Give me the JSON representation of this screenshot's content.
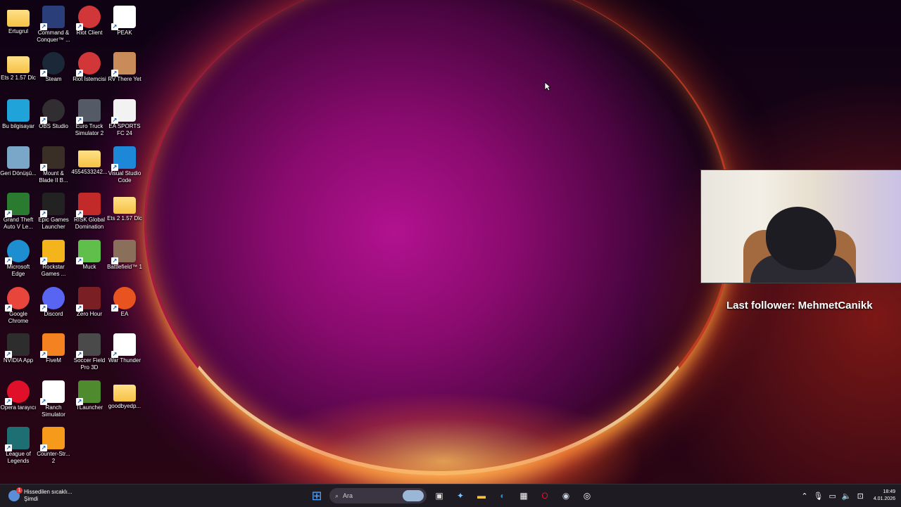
{
  "desktop": {
    "icons": [
      {
        "label": "Ertugrul",
        "icon": "folder-icon",
        "color": "#f5c242"
      },
      {
        "label": "Command & Conquer™ ...",
        "icon": "command-conquer-icon",
        "color": "#2a3f7a"
      },
      {
        "label": "Riot Client",
        "icon": "riot-client-icon",
        "color": "#d13639"
      },
      {
        "label": "PEAK",
        "icon": "file-icon",
        "color": "#ffffff"
      },
      {
        "label": "Ets 2 1.57 Dlc",
        "icon": "folder-icon",
        "color": "#f5c242"
      },
      {
        "label": "Steam",
        "icon": "steam-icon",
        "color": "#1b2838"
      },
      {
        "label": "Riot İstemcisi",
        "icon": "riot-client-icon",
        "color": "#d13639"
      },
      {
        "label": "RV There Yet",
        "icon": "rv-there-yet-icon",
        "color": "#c98b5a"
      },
      {
        "label": "Bu bilgisayar",
        "icon": "computer-icon",
        "color": "#1fa3d8"
      },
      {
        "label": "OBS Studio",
        "icon": "obs-icon",
        "color": "#302e31"
      },
      {
        "label": "Euro Truck Simulator 2",
        "icon": "euro-truck-icon",
        "color": "#555b66"
      },
      {
        "label": "EA SPORTS FC 24",
        "icon": "ea-fc-icon",
        "color": "#f2f2f2"
      },
      {
        "label": "Geri Dönüşü...",
        "icon": "recycle-bin-icon",
        "color": "#7aa6c8"
      },
      {
        "label": "Mount & Blade II B...",
        "icon": "mount-blade-icon",
        "color": "#3a2f26"
      },
      {
        "label": "4554533242...",
        "icon": "folder-icon",
        "color": "#f5c242"
      },
      {
        "label": "Visual Studio Code",
        "icon": "vscode-icon",
        "color": "#1e88d8"
      },
      {
        "label": "Grand Theft Auto V Le...",
        "icon": "gta-icon",
        "color": "#2a7a2f"
      },
      {
        "label": "Epic Games Launcher",
        "icon": "epic-games-icon",
        "color": "#222222"
      },
      {
        "label": "RISK Global Domination",
        "icon": "risk-icon",
        "color": "#c22a2a"
      },
      {
        "label": "Ets 2 1.57 Dlc",
        "icon": "folder-icon",
        "color": "#f5c242"
      },
      {
        "label": "Microsoft Edge",
        "icon": "edge-icon",
        "color": "#1d8fd1"
      },
      {
        "label": "Rockstar Games ...",
        "icon": "rockstar-icon",
        "color": "#f3b51b"
      },
      {
        "label": "Muck",
        "icon": "muck-icon",
        "color": "#5fbf4a"
      },
      {
        "label": "Battlefield™ 1",
        "icon": "battlefield-icon",
        "color": "#8a6f5a"
      },
      {
        "label": "Google Chrome",
        "icon": "chrome-icon",
        "color": "#e8453c"
      },
      {
        "label": "Discord",
        "icon": "discord-icon",
        "color": "#5865f2"
      },
      {
        "label": "Zero Hour",
        "icon": "zero-hour-icon",
        "color": "#7a1f24"
      },
      {
        "label": "EA",
        "icon": "ea-icon",
        "color": "#e8531f"
      },
      {
        "label": "NVIDIA App",
        "icon": "nvidia-icon",
        "color": "#2d2d2d"
      },
      {
        "label": "FiveM",
        "icon": "fivem-icon",
        "color": "#f58220"
      },
      {
        "label": "Soccer Field Pro 3D",
        "icon": "soccer-field-icon",
        "color": "#4a4a4a"
      },
      {
        "label": "War Thunder",
        "icon": "war-thunder-icon",
        "color": "#ffffff"
      },
      {
        "label": "Opera tarayıcı",
        "icon": "opera-icon",
        "color": "#e0102b"
      },
      {
        "label": "Ranch Simulator",
        "icon": "ranch-simulator-icon",
        "color": "#ffffff"
      },
      {
        "label": "TLauncher",
        "icon": "tlauncher-icon",
        "color": "#4f8a2f"
      },
      {
        "label": "goodbyedp...",
        "icon": "folder-icon",
        "color": "#f5c242"
      },
      {
        "label": "League of Legends",
        "icon": "league-icon",
        "color": "#1d6f74"
      },
      {
        "label": "Counter-Str... 2",
        "icon": "counter-strike-icon",
        "color": "#f59a1b"
      }
    ]
  },
  "overlay": {
    "follower_text": "Last follower: MehmetCanikk"
  },
  "taskbar": {
    "weather_title": "Hissedilen sıcaklı...",
    "weather_subtitle": "Şimdi",
    "weather_badge": "1",
    "search_placeholder": "Ara",
    "time": "18:49",
    "date": "4.01.2026",
    "apps": [
      {
        "name": "start-button",
        "glyph": "⊞",
        "color": "#4ca0ff"
      },
      {
        "name": "task-view-button",
        "glyph": "▣",
        "color": "#dddddd"
      },
      {
        "name": "copilot-button",
        "glyph": "✦",
        "color": "#7fc3ff"
      },
      {
        "name": "file-explorer-button",
        "glyph": "▬",
        "color": "#f5c242"
      },
      {
        "name": "edge-taskbar-button",
        "glyph": "◐",
        "color": "#1d8fd1"
      },
      {
        "name": "store-button",
        "glyph": "▦",
        "color": "#ffffff"
      },
      {
        "name": "opera-taskbar-button",
        "glyph": "O",
        "color": "#e0102b"
      },
      {
        "name": "steam-taskbar-button",
        "glyph": "◉",
        "color": "#c7d5e0"
      },
      {
        "name": "obs-taskbar-button",
        "glyph": "◎",
        "color": "#ffffff"
      }
    ]
  }
}
